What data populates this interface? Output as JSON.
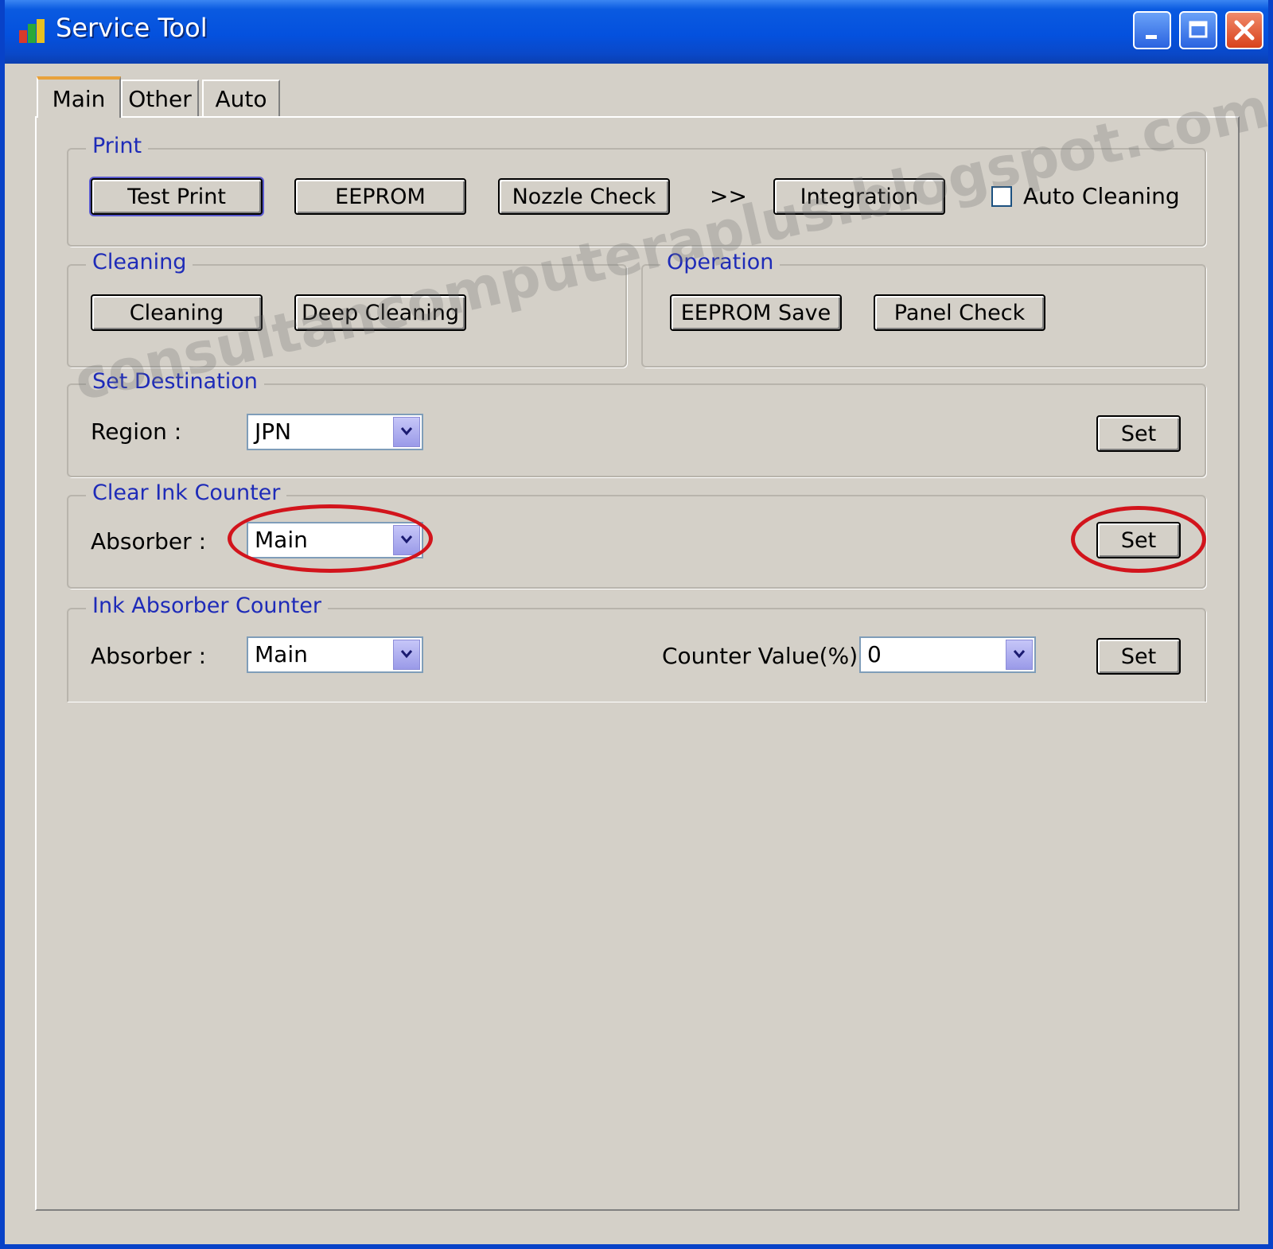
{
  "window": {
    "title": "Service Tool",
    "controls": {
      "minimize": "minimize-icon",
      "maximize": "maximize-icon",
      "close": "close-icon"
    }
  },
  "tabs": [
    {
      "label": "Main",
      "active": true
    },
    {
      "label": "Other",
      "active": false
    },
    {
      "label": "Auto",
      "active": false
    }
  ],
  "print_group": {
    "label": "Print",
    "buttons": [
      "Test Print",
      "EEPROM",
      "Nozzle Check",
      "Integration"
    ],
    "arrow": ">>",
    "auto_cleaning_label": "Auto Cleaning",
    "auto_cleaning_checked": false
  },
  "cleaning_group": {
    "label": "Cleaning",
    "buttons": [
      "Cleaning",
      "Deep Cleaning"
    ]
  },
  "operation_group": {
    "label": "Operation",
    "buttons": [
      "EEPROM Save",
      "Panel Check"
    ]
  },
  "set_destination": {
    "label": "Set Destination",
    "region_label": "Region :",
    "region_value": "JPN",
    "set_label": "Set"
  },
  "clear_ink_counter": {
    "label": "Clear Ink Counter",
    "absorber_label": "Absorber :",
    "absorber_value": "Main",
    "set_label": "Set"
  },
  "ink_absorber_counter": {
    "label": "Ink Absorber Counter",
    "absorber_label": "Absorber :",
    "absorber_value": "Main",
    "counter_label": "Counter Value(%) :",
    "counter_value": "0",
    "set_label": "Set"
  },
  "watermark": "consultancomputeraplus.blogspot.com",
  "colors": {
    "titlebar": "#0451de",
    "face": "#d4d0c8",
    "group_label": "#1e2bb8",
    "highlight_ellipse": "#d2141c"
  }
}
